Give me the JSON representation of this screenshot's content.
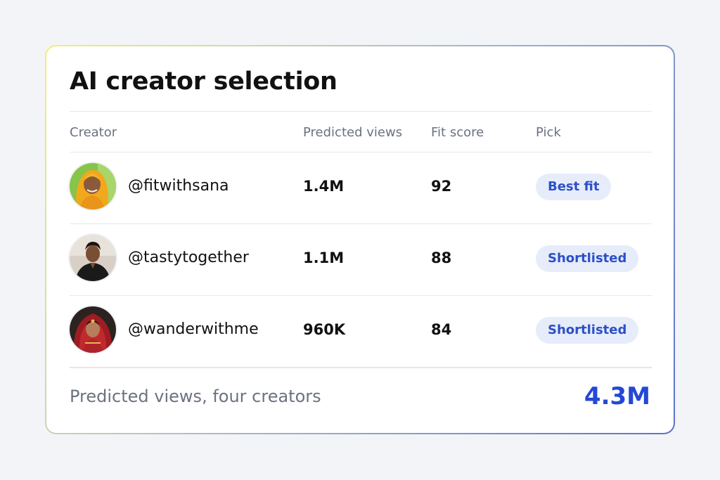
{
  "card": {
    "title": "AI creator selection"
  },
  "table": {
    "columns": [
      "Creator",
      "Predicted views",
      "Fit score",
      "Pick"
    ],
    "rows": [
      {
        "handle": "@fitwithsana",
        "views": "1.4M",
        "score": "92",
        "pick": "Best fit",
        "avatar": "avatar-woman-yellow-scarf"
      },
      {
        "handle": "@tastytogether",
        "views": "1.1M",
        "score": "88",
        "pick": "Shortlisted",
        "avatar": "avatar-man-dark-shirt"
      },
      {
        "handle": "@wanderwithme",
        "views": "960K",
        "score": "84",
        "pick": "Shortlisted",
        "avatar": "avatar-woman-red-veil"
      }
    ]
  },
  "footer": {
    "label": "Predicted views, four creators",
    "total": "4.3M"
  },
  "colors": {
    "accent": "#2348d6",
    "pill_bg": "#e7ecfb",
    "pill_text": "#2b50c8",
    "muted_text": "#6b7280"
  }
}
